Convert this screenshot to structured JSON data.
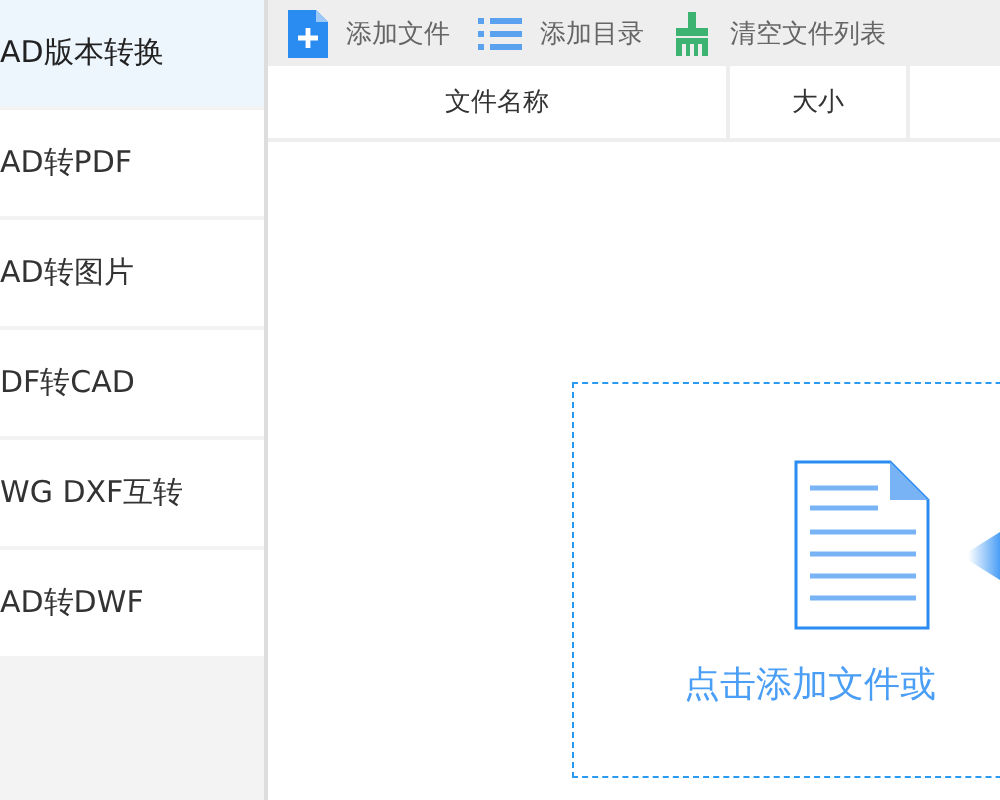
{
  "sidebar": {
    "items": [
      {
        "label": "AD版本转换",
        "selected": true
      },
      {
        "label": "AD转PDF",
        "selected": false
      },
      {
        "label": "AD转图片",
        "selected": false
      },
      {
        "label": "DF转CAD",
        "selected": false
      },
      {
        "label": "WG DXF互转",
        "selected": false
      },
      {
        "label": "AD转DWF",
        "selected": false
      }
    ]
  },
  "toolbar": [
    {
      "kind": "add-file",
      "label": "添加文件"
    },
    {
      "kind": "add-folder",
      "label": "添加目录"
    },
    {
      "kind": "clear",
      "label": "清空文件列表"
    }
  ],
  "table": {
    "columns": [
      "文件名称",
      "大小"
    ]
  },
  "drop_zone": {
    "text": "点击添加文件或"
  }
}
